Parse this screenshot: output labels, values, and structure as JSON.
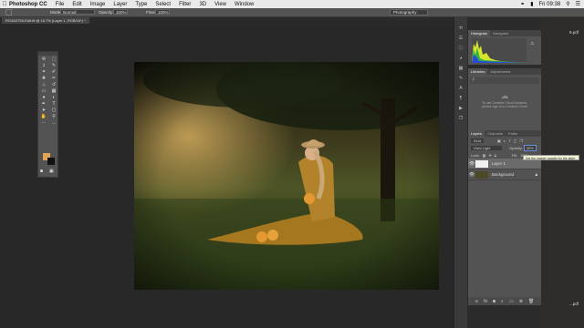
{
  "menubar": {
    "app_name": "Photoshop CC",
    "items": [
      "File",
      "Edit",
      "Image",
      "Layer",
      "Type",
      "Select",
      "Filter",
      "3D",
      "View",
      "Window"
    ],
    "clock": "Fri 09:38"
  },
  "options_bar": {
    "mode_label": "Mode:",
    "mode_value": "Normal",
    "opacity_label": "Opacity:",
    "opacity_value": "100%",
    "flow_label": "Flow:",
    "flow_value": "100%",
    "workspace": "Photography"
  },
  "document_tab": {
    "label": "RG3A0755-Edit.tif @ 16.7% (Layer 1, RGB/16*) *"
  },
  "histogram_panel": {
    "tabs": [
      "Histogram",
      "Navigator"
    ]
  },
  "libraries_panel": {
    "tabs": [
      "Libraries",
      "Adjustments"
    ],
    "message_line1": "To use Creative Cloud Libraries,",
    "message_line2": "please sign in to Creative Cloud"
  },
  "layers_panel": {
    "tabs": [
      "Layers",
      "Channels",
      "Paths"
    ],
    "filter_label": "Kind",
    "blend_mode": "Vivid Light",
    "opacity_label": "Opacity:",
    "opacity_value": "39%",
    "lock_label": "Lock:",
    "fill_label": "Fill:",
    "fill_value": "100%",
    "layers": [
      {
        "name": "Layer 1"
      },
      {
        "name": "Background"
      }
    ],
    "tooltip": "Set the master opacity for the layer"
  },
  "desktop": {
    "files": [
      "9.pdf",
      "...pdf"
    ]
  },
  "colors": {
    "foreground": "#e0a452",
    "background": "#111111",
    "accent": "#6a8fd8"
  }
}
